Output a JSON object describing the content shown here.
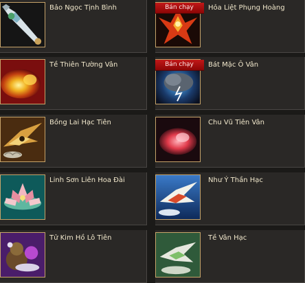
{
  "items": [
    {
      "name": "Bảo Ngọc Tịnh Bình",
      "badge": "",
      "icon": "jade-vase-icon"
    },
    {
      "name": "Hỏa Liệt Phụng Hoàng",
      "badge": "Bán chạy",
      "icon": "fire-phoenix-icon"
    },
    {
      "name": "Tề Thiên Tường Vân",
      "badge": "",
      "icon": "golden-cloud-icon"
    },
    {
      "name": "Bát Mặc Ô Vân",
      "badge": "Bán chạy",
      "icon": "storm-cloud-icon"
    },
    {
      "name": "Bồng Lai Hạc Tiên",
      "badge": "",
      "icon": "golden-crane-icon"
    },
    {
      "name": "Chu Vũ Tiên Vân",
      "badge": "",
      "icon": "red-cloud-icon"
    },
    {
      "name": "Linh Sơn Liên Hoa Đài",
      "badge": "",
      "icon": "lotus-platform-icon"
    },
    {
      "name": "Như Ý Thần Hạc",
      "badge": "",
      "icon": "sky-crane-icon"
    },
    {
      "name": "Tử Kim Hồ Lô Tiên",
      "badge": "",
      "icon": "gourd-icon"
    },
    {
      "name": "Tề Vân Hạc",
      "badge": "",
      "icon": "cloud-crane-icon"
    }
  ]
}
